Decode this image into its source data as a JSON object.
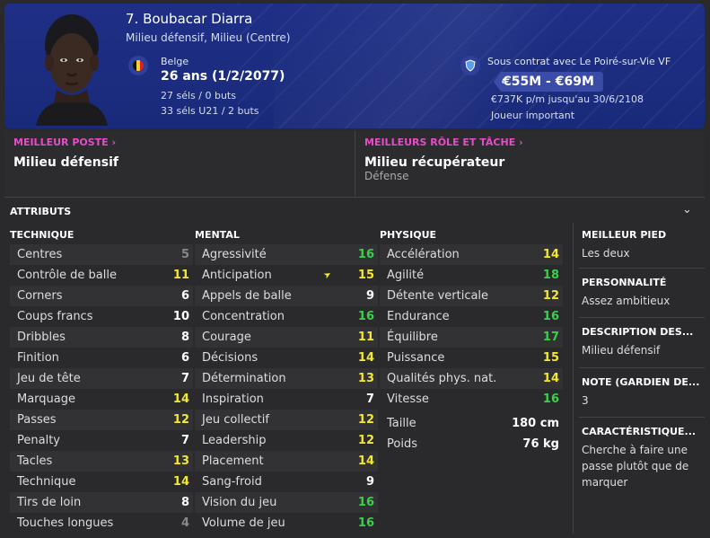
{
  "player": {
    "name": "7. Boubacar Diarra",
    "positions": "Milieu défensif, Milieu (Centre)",
    "nationality": "Belge",
    "age": "26 ans (1/2/2077)",
    "caps": "27 séls / 0 buts",
    "caps_u21": "33 séls U21 / 2 buts",
    "contract": "Sous contrat avec Le Poiré-sur-Vie VF",
    "value": "€55M - €69M",
    "wage": "€737K p/m jusqu'au 30/6/2108",
    "status": "Joueur important"
  },
  "best_position": {
    "label": "MEILLEUR POSTE",
    "value": "Milieu défensif"
  },
  "best_role": {
    "label": "MEILLEURS RÔLE ET TÂCHE",
    "value": "Milieu récupérateur",
    "duty": "Défense"
  },
  "attributes_title": "ATTRIBUTS",
  "colors": {
    "header": "#1e2f86",
    "accent": "#e64cc8",
    "yellow": "#f3e830",
    "green": "#3ad14a"
  },
  "technique": {
    "title": "TECHNIQUE",
    "rows": [
      {
        "name": "Centres",
        "value": "5"
      },
      {
        "name": "Contrôle de balle",
        "value": "11"
      },
      {
        "name": "Corners",
        "value": "6"
      },
      {
        "name": "Coups francs",
        "value": "10"
      },
      {
        "name": "Dribbles",
        "value": "8"
      },
      {
        "name": "Finition",
        "value": "6"
      },
      {
        "name": "Jeu de tête",
        "value": "7"
      },
      {
        "name": "Marquage",
        "value": "14"
      },
      {
        "name": "Passes",
        "value": "12"
      },
      {
        "name": "Penalty",
        "value": "7"
      },
      {
        "name": "Tacles",
        "value": "13"
      },
      {
        "name": "Technique",
        "value": "14"
      },
      {
        "name": "Tirs de loin",
        "value": "8"
      },
      {
        "name": "Touches longues",
        "value": "4"
      }
    ]
  },
  "mental": {
    "title": "MENTAL",
    "rows": [
      {
        "name": "Agressivité",
        "value": "16"
      },
      {
        "name": "Anticipation",
        "value": "15"
      },
      {
        "name": "Appels de balle",
        "value": "9"
      },
      {
        "name": "Concentration",
        "value": "16"
      },
      {
        "name": "Courage",
        "value": "11"
      },
      {
        "name": "Décisions",
        "value": "14"
      },
      {
        "name": "Détermination",
        "value": "13"
      },
      {
        "name": "Inspiration",
        "value": "7"
      },
      {
        "name": "Jeu collectif",
        "value": "12"
      },
      {
        "name": "Leadership",
        "value": "12"
      },
      {
        "name": "Placement",
        "value": "14"
      },
      {
        "name": "Sang-froid",
        "value": "9"
      },
      {
        "name": "Vision du jeu",
        "value": "16"
      },
      {
        "name": "Volume de jeu",
        "value": "16"
      }
    ]
  },
  "physique": {
    "title": "PHYSIQUE",
    "rows": [
      {
        "name": "Accélération",
        "value": "14"
      },
      {
        "name": "Agilité",
        "value": "18"
      },
      {
        "name": "Détente verticale",
        "value": "12"
      },
      {
        "name": "Endurance",
        "value": "16"
      },
      {
        "name": "Équilibre",
        "value": "17"
      },
      {
        "name": "Puissance",
        "value": "15"
      },
      {
        "name": "Qualités phys. nat.",
        "value": "14"
      },
      {
        "name": "Vitesse",
        "value": "16"
      }
    ],
    "height_label": "Taille",
    "height": "180 cm",
    "weight_label": "Poids",
    "weight": "76 kg"
  },
  "side": {
    "foot_label": "MEILLEUR PIED",
    "foot": "Les deux",
    "personality_label": "PERSONNALITÉ",
    "personality": "Assez ambitieux",
    "desc_label": "DESCRIPTION DES...",
    "desc": "Milieu défensif",
    "gk_label": "NOTE (GARDIEN DE...",
    "gk": "3",
    "traits_label": "CARACTÉRISTIQUE...",
    "traits": "Cherche à faire une passe plutôt que de marquer"
  }
}
